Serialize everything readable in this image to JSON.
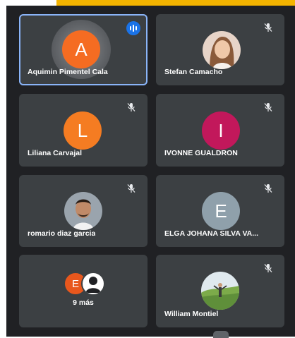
{
  "participants": [
    {
      "name": "Aquimin Pimentel Cala",
      "initial": "A",
      "avatar_color": "#f56c22",
      "speaking": true,
      "muted": false
    },
    {
      "name": "Stefan Camacho",
      "initial": "",
      "avatar_color": "",
      "speaking": false,
      "muted": true
    },
    {
      "name": "Liliana Carvajal",
      "initial": "L",
      "avatar_color": "#f57c22",
      "speaking": false,
      "muted": true
    },
    {
      "name": "IVONNE GUALDRON",
      "initial": "I",
      "avatar_color": "#c2185b",
      "speaking": false,
      "muted": true
    },
    {
      "name": "romario diaz garcia",
      "initial": "",
      "avatar_color": "",
      "speaking": false,
      "muted": true
    },
    {
      "name": "ELGA JOHANA SILVA VA...",
      "initial": "E",
      "avatar_color": "#8fa0ab",
      "speaking": false,
      "muted": true
    },
    {
      "name": "William Montiel",
      "initial": "",
      "avatar_color": "",
      "speaking": false,
      "muted": true
    }
  ],
  "overflow": {
    "label": "9 más",
    "initial": "E",
    "avatar_color": "#e8571d"
  },
  "colors": {
    "background": "#202124",
    "tile": "#3c4043",
    "active_outline": "#8ab4f8",
    "top_bar": "#f4b400"
  },
  "icons": {
    "mute": "mic-off-icon",
    "speaking": "audio-levels-icon",
    "generic_user": "person-icon"
  }
}
